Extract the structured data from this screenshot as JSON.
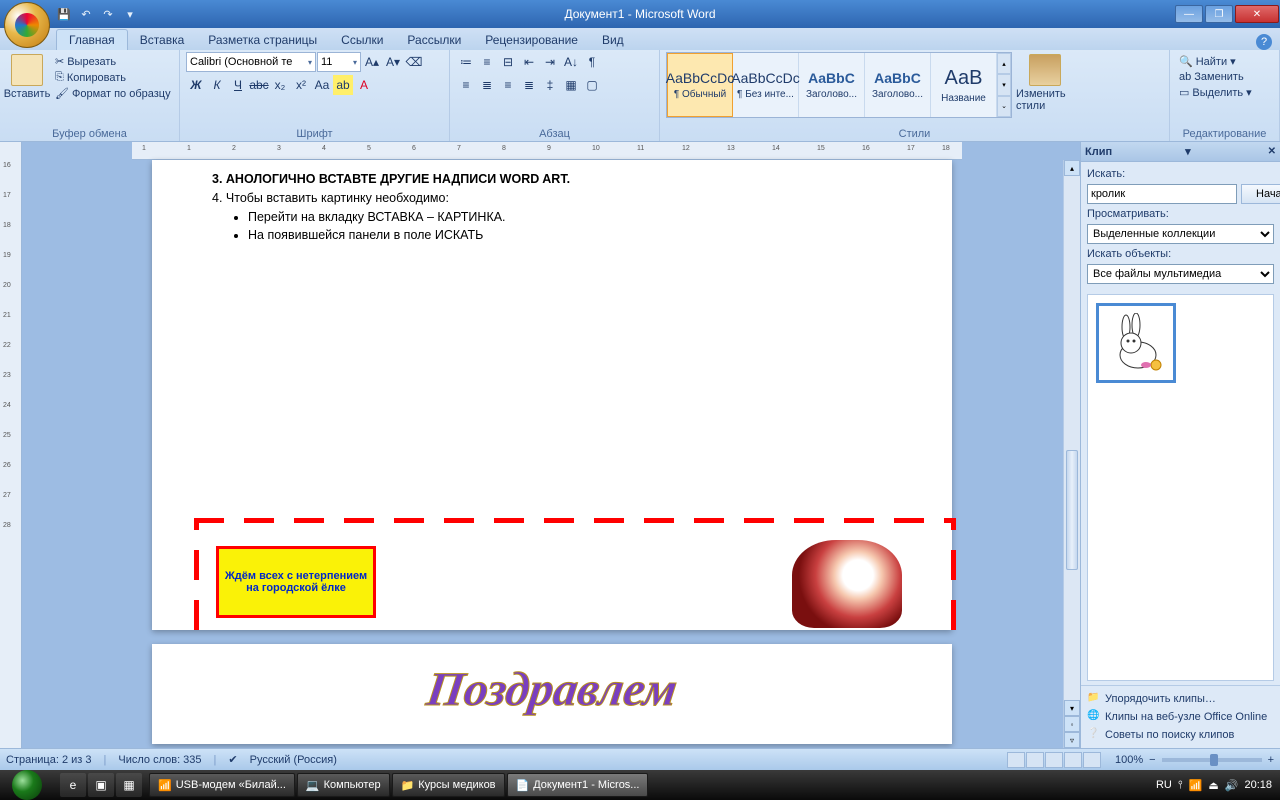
{
  "titlebar": {
    "title": "Документ1 - Microsoft Word"
  },
  "tabs": {
    "home": "Главная",
    "insert": "Вставка",
    "layout": "Разметка страницы",
    "refs": "Ссылки",
    "mail": "Рассылки",
    "review": "Рецензирование",
    "view": "Вид"
  },
  "ribbon": {
    "paste": "Вставить",
    "cut": "Вырезать",
    "copy": "Копировать",
    "fmt": "Формат по образцу",
    "clipboard_grp": "Буфер обмена",
    "font_name": "Calibri (Основной те",
    "font_size": "11",
    "font_grp": "Шрифт",
    "para_grp": "Абзац",
    "styles_grp": "Стили",
    "style1": "¶ Обычный",
    "style2": "¶ Без инте...",
    "style3": "Заголово...",
    "style4": "Заголово...",
    "style5": "Название",
    "style_sample": "AaBbCcDc",
    "style_sample_h": "AaBbC",
    "style_sample_t": "АаВ",
    "change_styles": "Изменить стили",
    "find": "Найти",
    "replace": "Заменить",
    "select": "Выделить",
    "editing_grp": "Редактирование"
  },
  "doc": {
    "line3": "3. АНОЛОГИЧНО ВСТАВТЕ ДРУГИЕ НАДПИСИ  WORD ART.",
    "line4": "4. Чтобы вставить картинку необходимо:",
    "bullet1": "Перейти на вкладку ВСТАВКА – КАРТИНКА.",
    "bullet2": "На появившейся панели в поле ИСКАТЬ",
    "yellow": "Ждём всех с нетерпением на городской ёлке",
    "wordart": "Поздравлем"
  },
  "clip": {
    "title": "Клип",
    "search_lbl": "Искать:",
    "search_val": "кролик",
    "go": "Начать",
    "browse_lbl": "Просматривать:",
    "browse_val": "Выделенные коллекции",
    "objects_lbl": "Искать объекты:",
    "objects_val": "Все файлы мультимедиа",
    "organize": "Упорядочить клипы…",
    "online": "Клипы на веб-узле Office Online",
    "tips": "Советы по поиску клипов"
  },
  "status": {
    "page": "Страница: 2 из 3",
    "words": "Число слов: 335",
    "lang": "Русский (Россия)",
    "zoom": "100%"
  },
  "taskbar": {
    "t1": "USB-модем «Билай...",
    "t2": "Компьютер",
    "t3": "Курсы медиков",
    "t4": "Документ1 - Micros...",
    "lang": "RU",
    "time": "20:18"
  }
}
